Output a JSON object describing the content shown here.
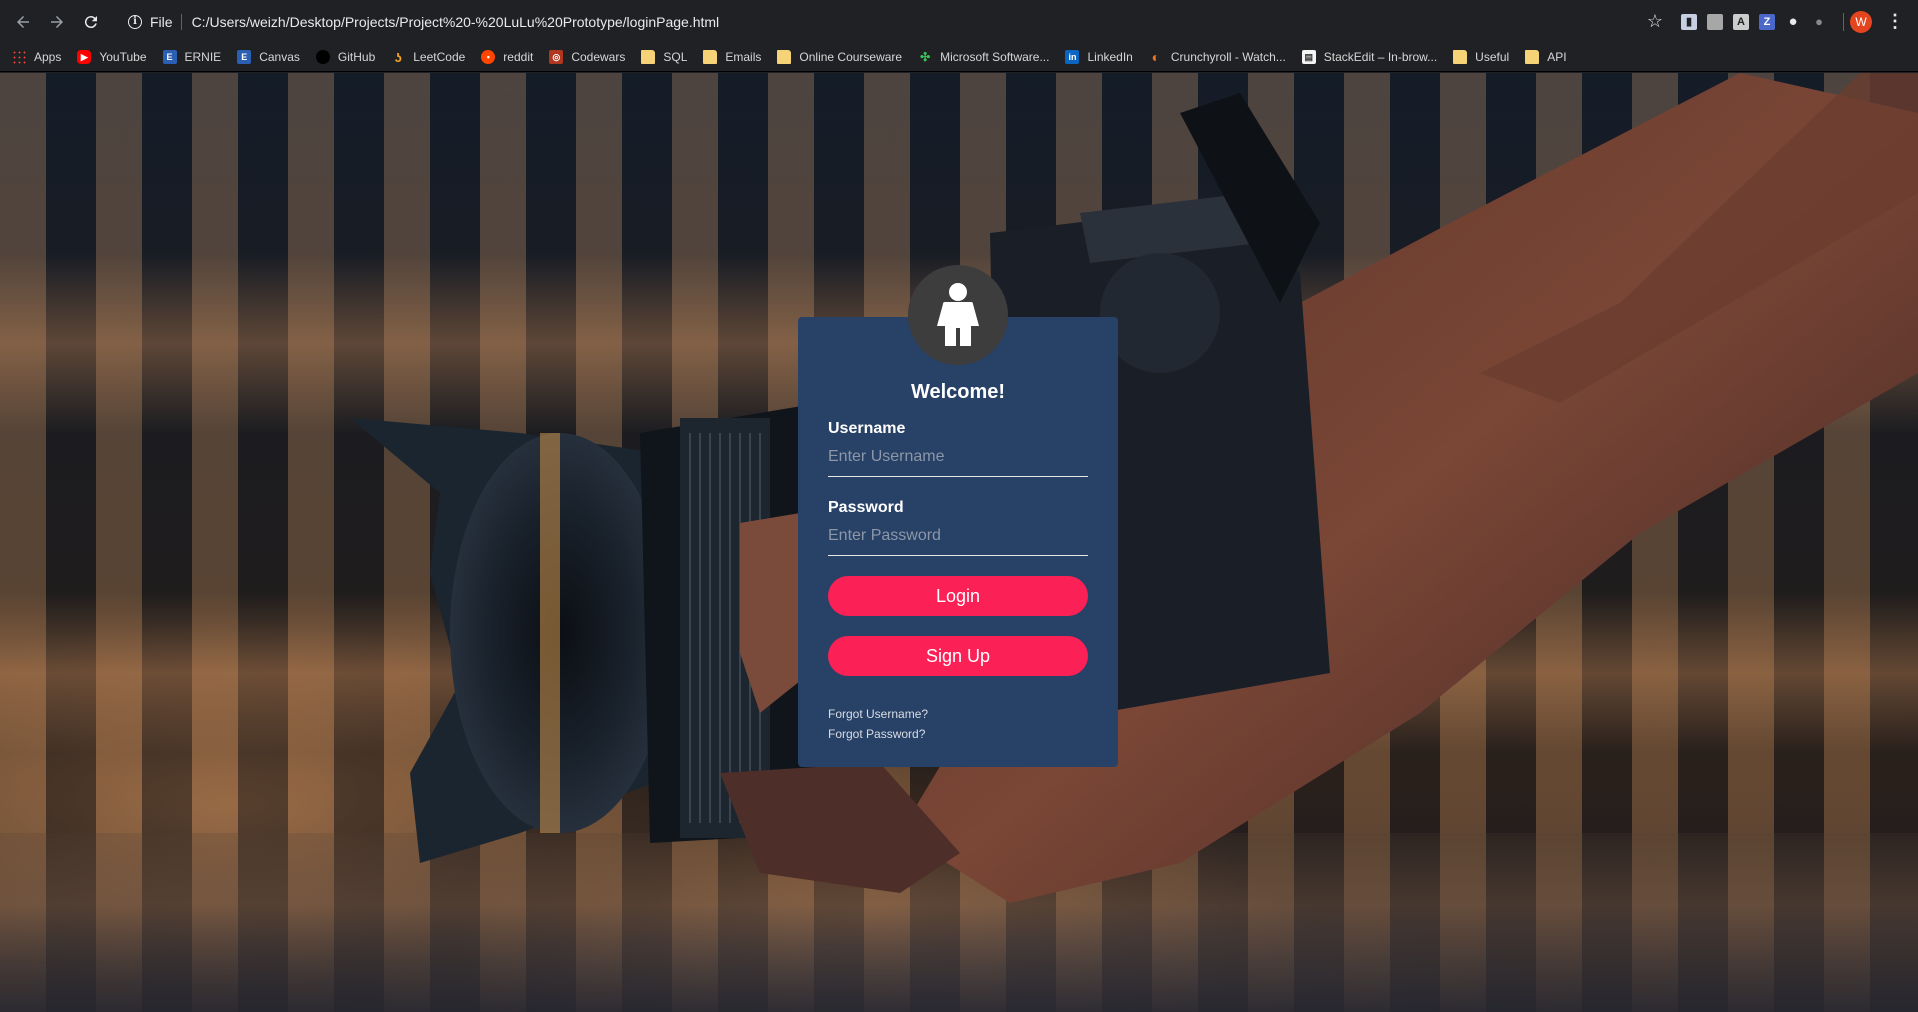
{
  "browser": {
    "scheme": "File",
    "url": "C:/Users/weizh/Desktop/Projects/Project%20-%20LuLu%20Prototype/loginPage.html",
    "profile_initial": "W"
  },
  "bookmarks": [
    {
      "label": "Apps",
      "icon": "apps-icon"
    },
    {
      "label": "YouTube",
      "icon": "youtube-icon"
    },
    {
      "label": "ERNIE",
      "icon": "ernie-icon"
    },
    {
      "label": "Canvas",
      "icon": "canvas-icon"
    },
    {
      "label": "GitHub",
      "icon": "github-icon"
    },
    {
      "label": "LeetCode",
      "icon": "leetcode-icon"
    },
    {
      "label": "reddit",
      "icon": "reddit-icon"
    },
    {
      "label": "Codewars",
      "icon": "codewars-icon"
    },
    {
      "label": "SQL",
      "icon": "folder-icon"
    },
    {
      "label": "Emails",
      "icon": "folder-icon"
    },
    {
      "label": "Online Courseware",
      "icon": "folder-icon"
    },
    {
      "label": "Microsoft Software...",
      "icon": "microsoft-icon"
    },
    {
      "label": "LinkedIn",
      "icon": "linkedin-icon"
    },
    {
      "label": "Crunchyroll - Watch...",
      "icon": "crunchyroll-icon"
    },
    {
      "label": "StackEdit – In-brow...",
      "icon": "stackedit-icon"
    },
    {
      "label": "Useful",
      "icon": "folder-icon"
    },
    {
      "label": "API",
      "icon": "folder-icon"
    }
  ],
  "login": {
    "title": "Welcome!",
    "username_label": "Username",
    "username_placeholder": "Enter Username",
    "password_label": "Password",
    "password_placeholder": "Enter Password",
    "login_button": "Login",
    "signup_button": "Sign Up",
    "forgot_username": "Forgot Username?",
    "forgot_password": "Forgot Password?"
  },
  "colors": {
    "card_bg": "#284166",
    "button_bg": "#fb2056",
    "avatar_bg": "#3d3d3d"
  }
}
